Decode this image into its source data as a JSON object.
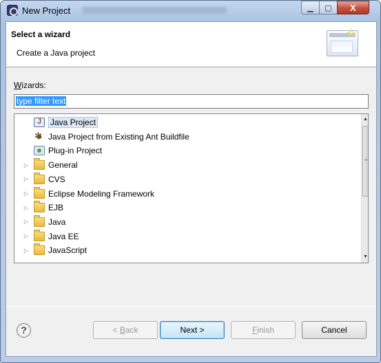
{
  "window": {
    "title": "New Project",
    "min_symbol": "▁",
    "max_symbol": "▢",
    "close_symbol": "X"
  },
  "header": {
    "title": "Select a wizard",
    "description": "Create a Java project"
  },
  "wizards_label_rest": "izards:",
  "wizards_label_mnemonic": "W",
  "filter": {
    "value": "type filter text"
  },
  "tree": {
    "items": [
      {
        "label": "Java Project",
        "icon": "java-project-icon",
        "expandable": false,
        "selected": true
      },
      {
        "label": "Java Project from Existing Ant Buildfile",
        "icon": "ant-icon",
        "expandable": false,
        "selected": false
      },
      {
        "label": "Plug-in Project",
        "icon": "plugin-project-icon",
        "expandable": false,
        "selected": false
      },
      {
        "label": "General",
        "icon": "folder-icon",
        "expandable": true
      },
      {
        "label": "CVS",
        "icon": "folder-icon",
        "expandable": true
      },
      {
        "label": "Eclipse Modeling Framework",
        "icon": "folder-icon",
        "expandable": true
      },
      {
        "label": "EJB",
        "icon": "folder-icon",
        "expandable": true
      },
      {
        "label": "Java",
        "icon": "folder-icon",
        "expandable": true
      },
      {
        "label": "Java EE",
        "icon": "folder-icon",
        "expandable": true
      },
      {
        "label": "JavaScript",
        "icon": "folder-icon",
        "expandable": true
      }
    ]
  },
  "scroll": {
    "up": "▲",
    "down": "▼",
    "grip": "≡"
  },
  "buttons": {
    "help": "?",
    "back": {
      "mnemonic": "B",
      "pre": "< ",
      "rest": "ack"
    },
    "next": "Next >",
    "finish": {
      "mnemonic": "F",
      "rest": "inish"
    },
    "cancel": "Cancel"
  }
}
